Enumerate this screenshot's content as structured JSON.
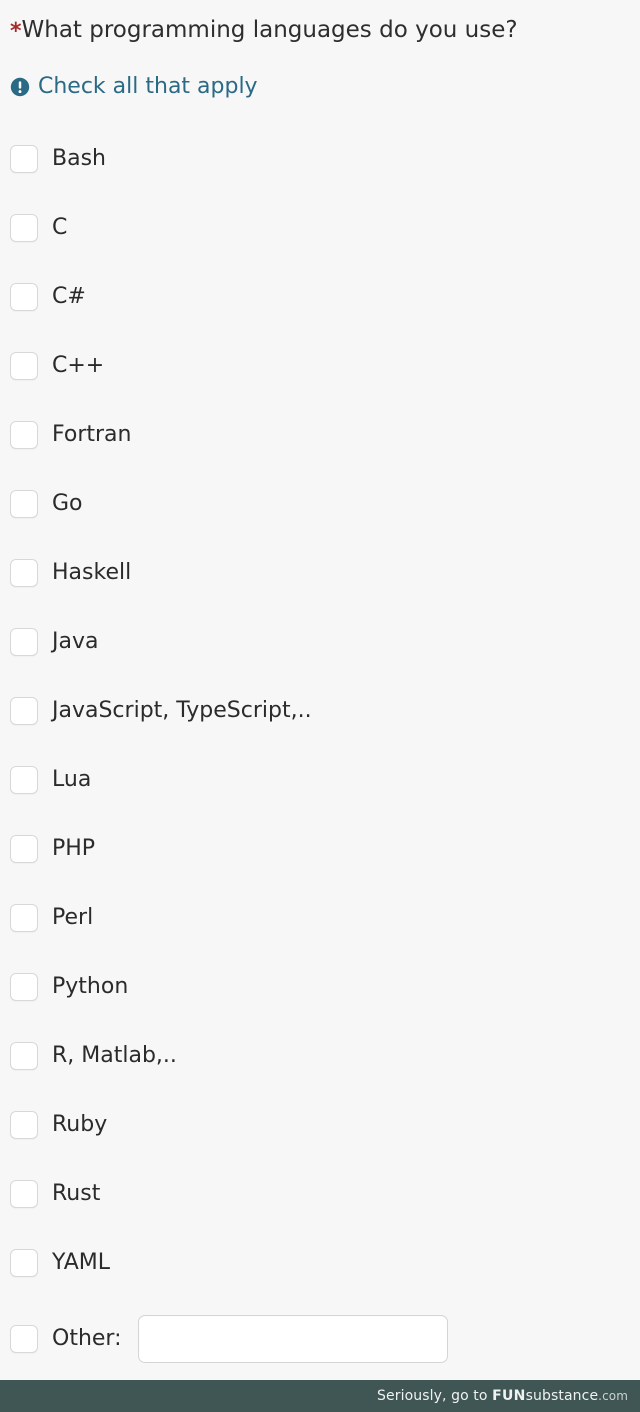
{
  "question": {
    "required_marker": "*",
    "title": "What programming languages do you use?",
    "hint": "Check all that apply",
    "hint_icon": "info-circle-icon",
    "hint_color": "#2a6a85",
    "required_color": "#a32b2b"
  },
  "options": [
    {
      "label": "Bash",
      "checked": false
    },
    {
      "label": "C",
      "checked": false
    },
    {
      "label": "C#",
      "checked": false
    },
    {
      "label": "C++",
      "checked": false
    },
    {
      "label": "Fortran",
      "checked": false
    },
    {
      "label": "Go",
      "checked": false
    },
    {
      "label": "Haskell",
      "checked": false
    },
    {
      "label": "Java",
      "checked": false
    },
    {
      "label": "JavaScript, TypeScript,..",
      "checked": false
    },
    {
      "label": "Lua",
      "checked": false
    },
    {
      "label": "PHP",
      "checked": false
    },
    {
      "label": "Perl",
      "checked": false
    },
    {
      "label": "Python",
      "checked": false
    },
    {
      "label": "R, Matlab,..",
      "checked": false
    },
    {
      "label": "Ruby",
      "checked": false
    },
    {
      "label": "Rust",
      "checked": false
    },
    {
      "label": "YAML",
      "checked": false
    }
  ],
  "other": {
    "label": "Other:",
    "checked": false,
    "value": "",
    "placeholder": ""
  },
  "watermark": {
    "prefix": "Seriously, go to ",
    "brand_bold": "FUN",
    "brand_rest": "substance",
    "tld": ".com",
    "background": "#3f5654",
    "text_color": "#f0f2f1"
  },
  "theme": {
    "page_background": "#f7f7f7",
    "checkbox_background": "#ffffff",
    "checkbox_border": "#d8d8d8",
    "text_color": "#2b2b2b"
  }
}
